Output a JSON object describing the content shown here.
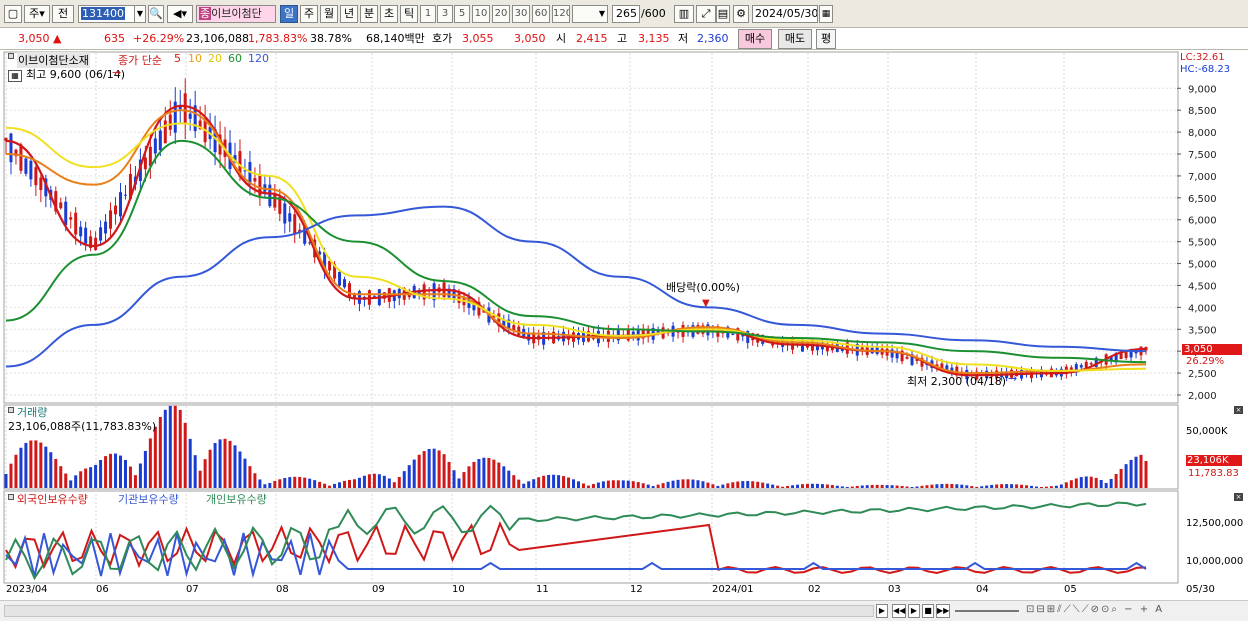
{
  "toolbar": {
    "market": "주",
    "market2": "전",
    "code": "131400",
    "stock_badge": "종",
    "stock_name": "이브이첨단",
    "periods": [
      "일",
      "주",
      "월",
      "년",
      "분",
      "초",
      "틱"
    ],
    "active_period": "일",
    "intervals": [
      "1",
      "3",
      "5",
      "10",
      "20",
      "30",
      "60",
      "120"
    ],
    "count": "265",
    "count_total": "/600",
    "date": "2024/05/30"
  },
  "quote": {
    "price": "3,050",
    "change": "635",
    "change_pct": "+26.29%",
    "volume": "23,106,088",
    "volume_pct": "1,783.83%",
    "turnover_pct": "38.78%",
    "amount": "68,140백만",
    "bid_label": "호가",
    "bid1": "3,055",
    "bid2": "3,050",
    "open_label": "시",
    "open": "2,415",
    "high_label": "고",
    "high": "3,135",
    "low_label": "저",
    "low": "2,360",
    "buy_label": "매수",
    "sell_label": "매도",
    "eval_label": "평"
  },
  "price_panel": {
    "title": "이브이첨단소재",
    "legend_price": "종가 단순",
    "ma_labels": [
      "5",
      "10",
      "20",
      "60",
      "120"
    ],
    "ma_colors": [
      "#d01818",
      "#e8801a",
      "#f0e020",
      "#1a9030",
      "#3558d8"
    ],
    "high_note": "최고 9,600 (06/14)",
    "low_note": "최저 2,300 (04/18)",
    "dividend_note": "배당락(0.00%)",
    "lc": "LC:32.61",
    "hc": "HC:-68.23",
    "current_tag": "3,050",
    "current_pct": "26.29%",
    "y_ticks": [
      "9,000",
      "8,500",
      "8,000",
      "7,500",
      "7,000",
      "6,500",
      "6,000",
      "5,500",
      "5,000",
      "4,500",
      "4,000",
      "3,500",
      "3,000",
      "2,500",
      "2,000"
    ]
  },
  "volume_panel": {
    "title": "거래량",
    "summary": "23,106,088주(11,783.83%)",
    "y_tick": "50,000K",
    "current_tag": "23,106K",
    "current_pct": "11,783.83"
  },
  "holdings_panel": {
    "legend": [
      "외국인보유수량",
      "기관보유수량",
      "개인보유수량"
    ],
    "legend_colors": [
      "#d01818",
      "#3558d8",
      "#2e8b57"
    ],
    "y_ticks": [
      "12,500,000",
      "10,000,000"
    ]
  },
  "x_axis": {
    "labels": [
      "2023/04",
      "06",
      "07",
      "08",
      "09",
      "10",
      "11",
      "12",
      "2024/01",
      "02",
      "03",
      "04",
      "05"
    ],
    "right_label": "05/30"
  },
  "chart_data": {
    "type": "line",
    "title": "이브이첨단소재",
    "x": [
      "2023/04",
      "06",
      "07",
      "08",
      "09",
      "10",
      "11",
      "12",
      "2024/01",
      "02",
      "03",
      "04",
      "05",
      "05/30"
    ],
    "series": [
      {
        "name": "5",
        "values": [
          7800,
          5400,
          8600,
          6600,
          4200,
          4400,
          3300,
          3350,
          3500,
          3150,
          3000,
          2450,
          2500,
          3050
        ]
      },
      {
        "name": "10",
        "values": [
          7500,
          6800,
          8500,
          6700,
          4300,
          4300,
          3400,
          3300,
          3550,
          3200,
          3000,
          2500,
          2550,
          2700
        ]
      },
      {
        "name": "20",
        "values": [
          8100,
          7200,
          8200,
          7000,
          4700,
          4200,
          3600,
          3350,
          3500,
          3250,
          3100,
          2700,
          2550,
          2600
        ]
      },
      {
        "name": "60",
        "values": [
          3700,
          5200,
          7800,
          6500,
          5500,
          4600,
          3800,
          3500,
          3450,
          3300,
          3200,
          3000,
          2850,
          2750
        ]
      },
      {
        "name": "120",
        "values": [
          2650,
          3600,
          4700,
          5600,
          6100,
          6300,
          5500,
          4700,
          4000,
          3600,
          3400,
          3250,
          3100,
          3000
        ]
      }
    ],
    "volume_k": [
      40000,
      15000,
      60000,
      8000,
      6000,
      30000,
      10000,
      5000,
      6000,
      3000,
      2000,
      3000,
      2000,
      23106
    ],
    "ylim": [
      2000,
      9600
    ],
    "high": {
      "label": "9,600",
      "date": "06/14"
    },
    "low": {
      "label": "2,300",
      "date": "04/18"
    }
  }
}
